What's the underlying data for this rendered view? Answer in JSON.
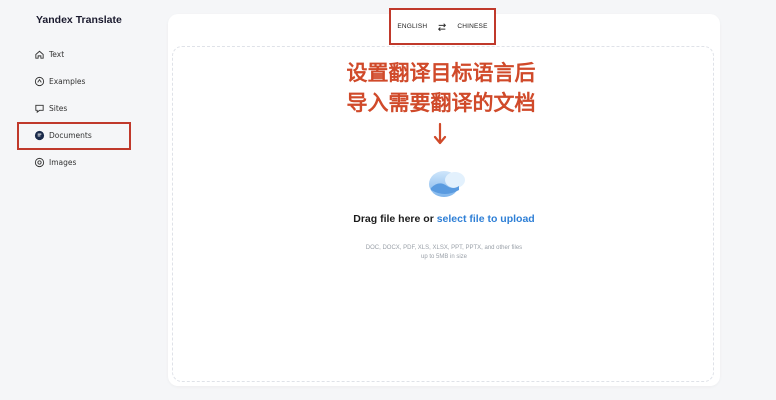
{
  "app": {
    "title": "Yandex Translate"
  },
  "sidebar": {
    "items": [
      {
        "label": "Text",
        "icon": "home-icon"
      },
      {
        "label": "Examples",
        "icon": "examples-icon"
      },
      {
        "label": "Sites",
        "icon": "globe-icon"
      },
      {
        "label": "Documents",
        "icon": "document-icon",
        "active": true
      },
      {
        "label": "Images",
        "icon": "image-icon"
      }
    ]
  },
  "languages": {
    "source": "ENGLISH",
    "target": "CHINESE"
  },
  "annotation": {
    "line1": "设置翻译目标语言后",
    "line2": "导入需要翻译的文档",
    "color": "#d04a2a"
  },
  "upload": {
    "prompt": "Drag file here or ",
    "link": "select file to upload",
    "formats": "DOC, DOCX, PDF, XLS, XLSX, PPT, PPTX, and other files up to 5MB in size"
  },
  "colors": {
    "highlight_border": "#c0392b",
    "link": "#2e7fd6",
    "active_icon": "#1a2a4a"
  }
}
